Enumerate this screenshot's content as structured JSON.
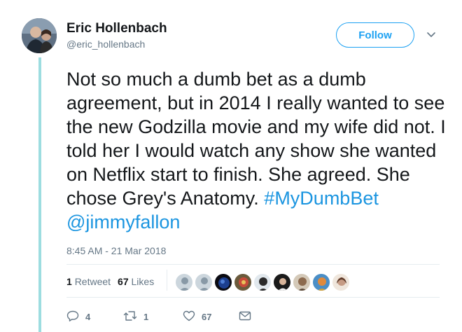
{
  "author": {
    "name": "Eric Hollenbach",
    "handle": "@eric_hollenbach"
  },
  "header": {
    "follow_label": "Follow"
  },
  "tweet": {
    "text_plain": "Not so much a dumb bet as a dumb agreement, but in 2014 I really wanted to see the new Godzilla movie and my wife did not. I told her I would watch any show she wanted on Netflix start to finish. She agreed. She chose Grey's Anatomy.",
    "hashtag": "#MyDumbBet",
    "mention": "@jimmyfallon",
    "timestamp": "8:45 AM - 21 Mar 2018"
  },
  "stats": {
    "retweets_count": "1",
    "retweets_label": "Retweet",
    "likes_count": "67",
    "likes_label": "Likes"
  },
  "actions": {
    "reply_count": "4",
    "retweet_count": "1",
    "like_count": "67"
  },
  "colors": {
    "accent": "#1da1f2",
    "link": "#1b95e0",
    "thread_line": "#9ddde0",
    "muted_text": "#657786"
  },
  "icons": {
    "reply": "reply-icon",
    "retweet": "retweet-icon",
    "like": "heart-icon",
    "message": "envelope-icon",
    "caret": "chevron-down-icon"
  }
}
